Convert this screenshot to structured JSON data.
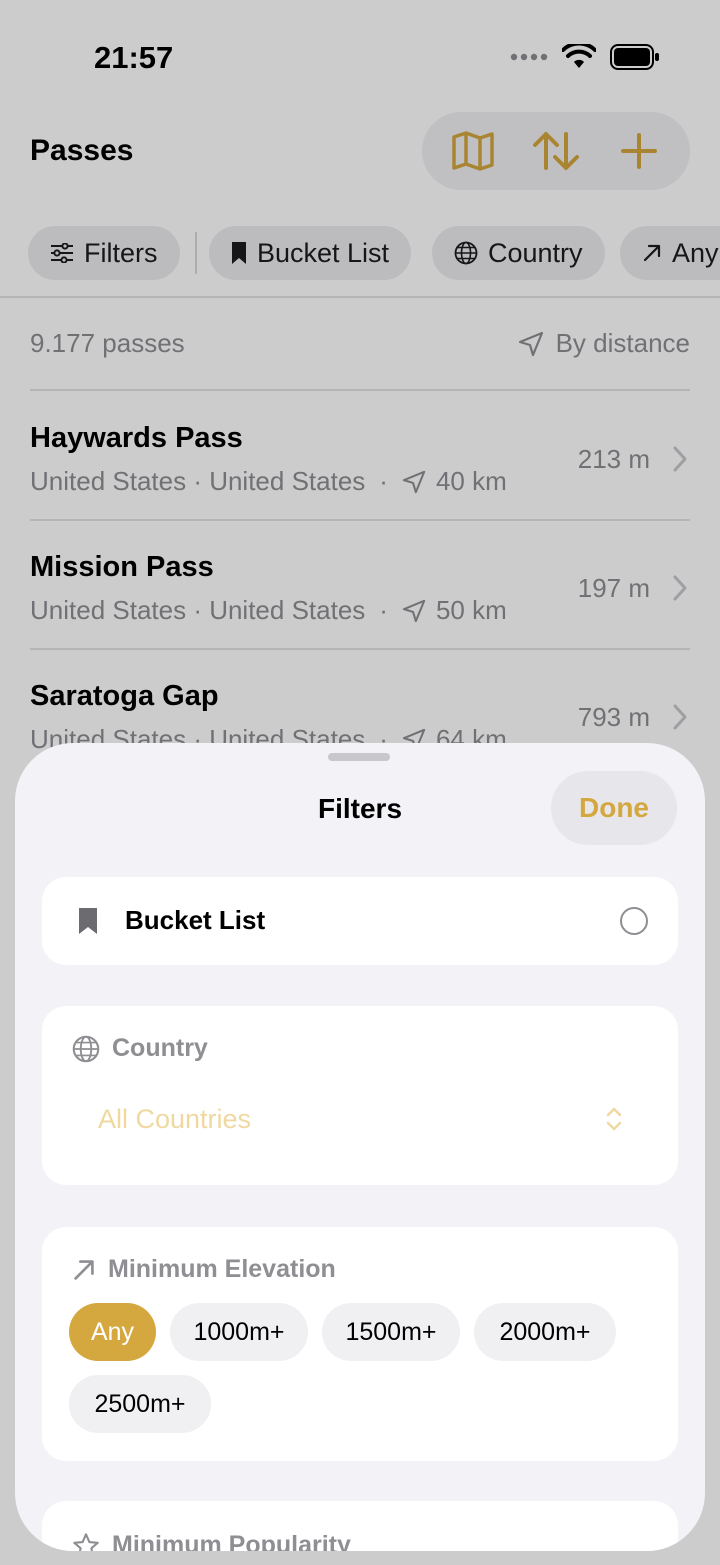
{
  "status_bar": {
    "time": "21:57"
  },
  "header": {
    "title": "Passes"
  },
  "colors": {
    "accent": "#d4a73f",
    "accent_light": "#efd9a0",
    "secondary_text": "#8e8e93",
    "sheet_bg": "#f2f2f7"
  },
  "filter_chips": [
    {
      "label": "Filters",
      "icon": "sliders-icon"
    },
    {
      "label": "Bucket List",
      "icon": "bookmark-icon"
    },
    {
      "label": "Country",
      "icon": "globe-icon"
    },
    {
      "label": "Any",
      "icon": "arrow-up-right-icon"
    }
  ],
  "list": {
    "count_text": "9.177 passes",
    "sort_label": "By distance",
    "items": [
      {
        "name": "Haywards Pass",
        "region": "United States · United States",
        "distance": "40 km",
        "elevation": "213 m"
      },
      {
        "name": "Mission Pass",
        "region": "United States · United States",
        "distance": "50 km",
        "elevation": "197 m"
      },
      {
        "name": "Saratoga Gap",
        "region": "United States · United States",
        "distance": "64 km",
        "elevation": "793 m"
      }
    ],
    "separator": "·"
  },
  "sheet": {
    "title": "Filters",
    "done_label": "Done",
    "bucket_list": {
      "label": "Bucket List",
      "checked": false
    },
    "country": {
      "heading": "Country",
      "value": "All Countries"
    },
    "elevation": {
      "heading": "Minimum Elevation",
      "options": [
        "Any",
        "1000m+",
        "1500m+",
        "2000m+",
        "2500m+"
      ],
      "selected": "Any"
    },
    "popularity": {
      "heading": "Minimum Popularity"
    }
  }
}
